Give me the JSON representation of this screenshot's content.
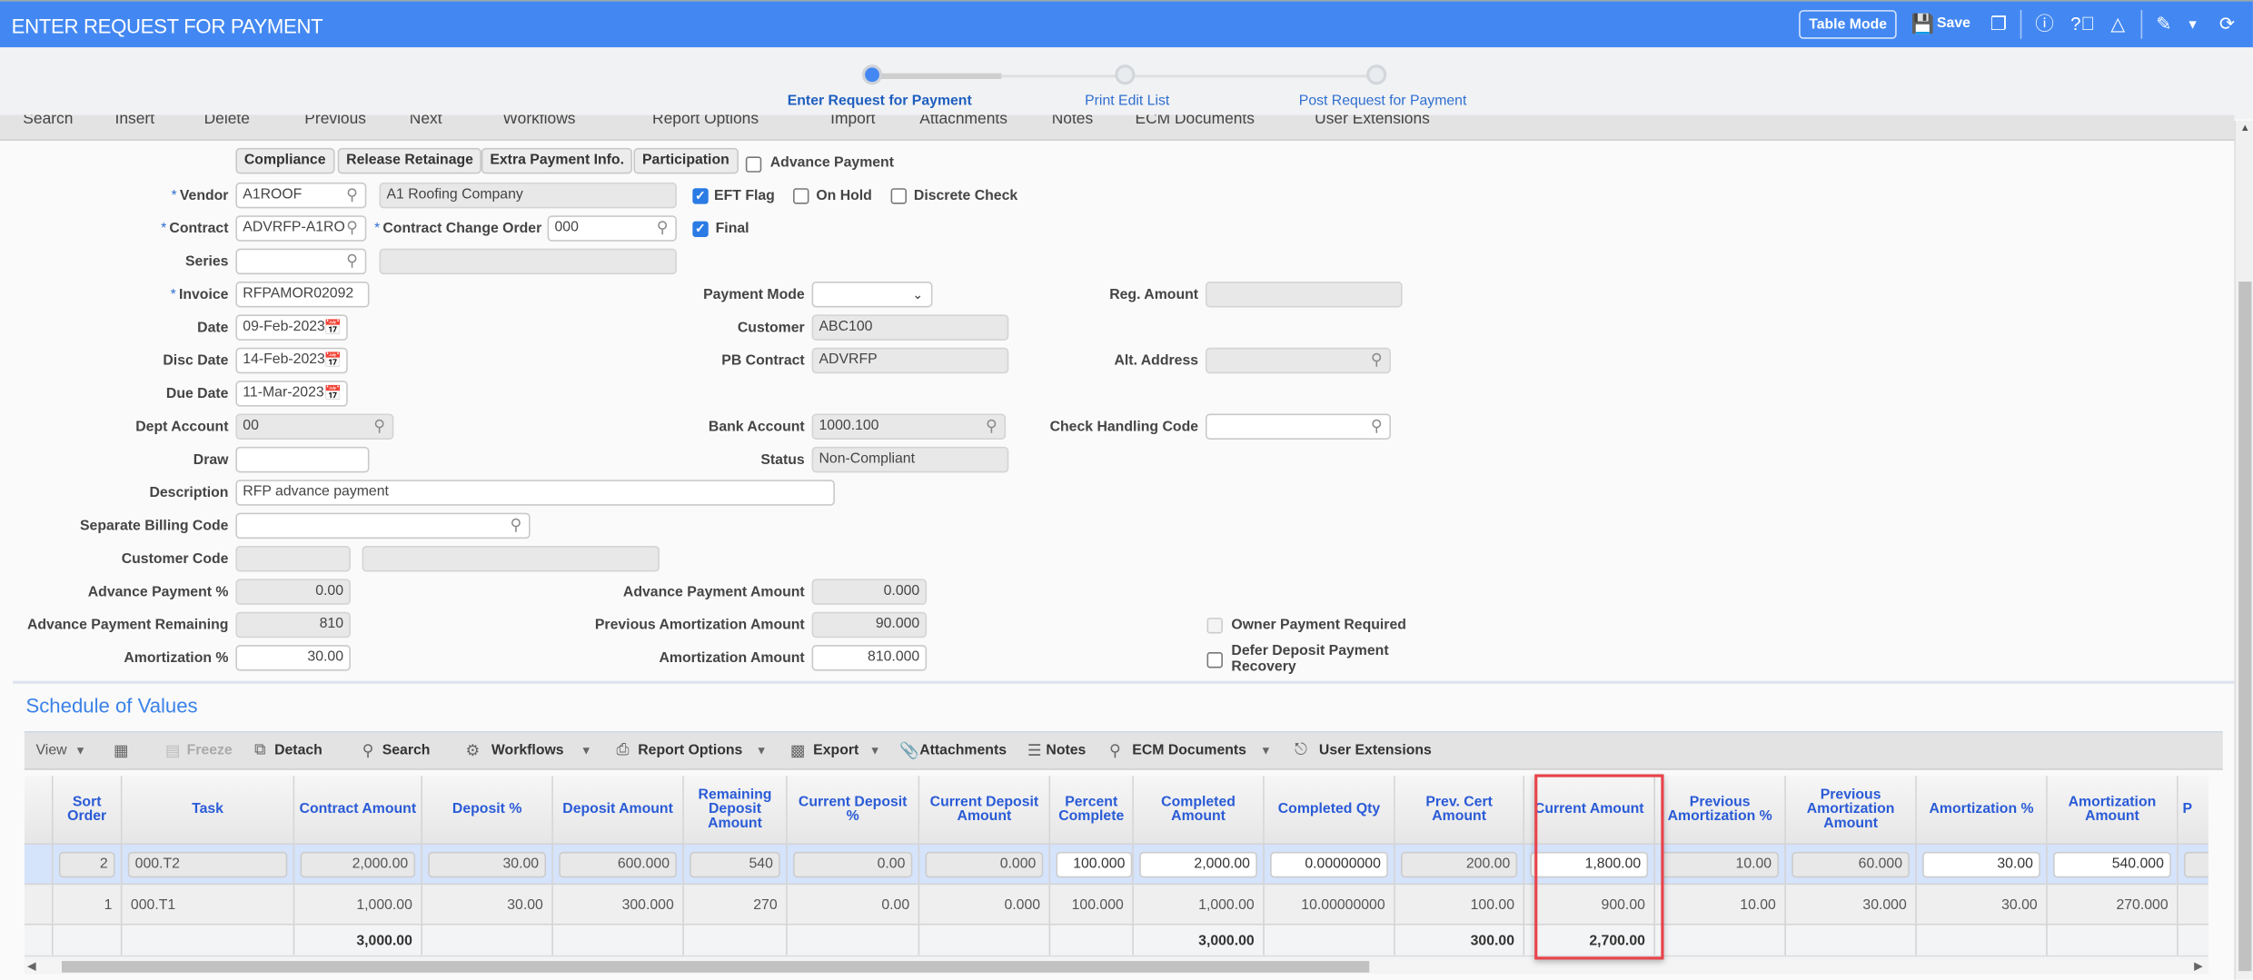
{
  "header": {
    "title": "ENTER REQUEST FOR PAYMENT",
    "table_mode_label": "Table Mode",
    "save_label": "Save",
    "icons": [
      "save-icon",
      "copy-icon",
      "info-icon",
      "help-icon",
      "warning-icon",
      "edit-icon",
      "dropdown-icon",
      "refresh-icon"
    ],
    "accent_color": "#4388f2"
  },
  "stepper": {
    "steps": [
      {
        "label": "Enter Request for Payment",
        "active": true
      },
      {
        "label": "Print Edit List",
        "active": false
      },
      {
        "label": "Post Request for Payment",
        "active": false
      }
    ]
  },
  "toolbar": {
    "items": [
      "Search",
      "Insert",
      "Delete",
      "Previous",
      "Next",
      "Workflows",
      "Report Options",
      "Import",
      "Attachments",
      "Notes",
      "ECM Documents",
      "User Extensions"
    ]
  },
  "form": {
    "buttons": [
      "Compliance",
      "Release Retainage",
      "Extra Payment Info.",
      "Participation"
    ],
    "advance_payment": {
      "label": "Advance Payment",
      "checked": false
    },
    "vendor": {
      "label": "Vendor",
      "value": "A1ROOF",
      "name": "A1 Roofing Company"
    },
    "eft_flag": {
      "label": "EFT Flag",
      "checked": true
    },
    "on_hold": {
      "label": "On Hold",
      "checked": false
    },
    "discrete_check": {
      "label": "Discrete Check",
      "checked": false
    },
    "contract": {
      "label": "Contract",
      "value": "ADVRFP-A1RO"
    },
    "contract_change_order": {
      "label": "Contract Change Order",
      "value": "000"
    },
    "final": {
      "label": "Final",
      "checked": true
    },
    "series": {
      "label": "Series",
      "value": "",
      "desc": ""
    },
    "invoice": {
      "label": "Invoice",
      "value": "RFPAMOR02092"
    },
    "payment_mode": {
      "label": "Payment Mode",
      "value": ""
    },
    "reg_amount": {
      "label": "Reg. Amount",
      "value": ""
    },
    "date": {
      "label": "Date",
      "value": "09-Feb-2023"
    },
    "customer": {
      "label": "Customer",
      "value": "ABC100"
    },
    "disc_date": {
      "label": "Disc Date",
      "value": "14-Feb-2023"
    },
    "pb_contract": {
      "label": "PB Contract",
      "value": "ADVRFP"
    },
    "alt_address": {
      "label": "Alt. Address",
      "value": ""
    },
    "due_date": {
      "label": "Due Date",
      "value": "11-Mar-2023"
    },
    "dept_account": {
      "label": "Dept Account",
      "value": "00"
    },
    "bank_account": {
      "label": "Bank Account",
      "value": "1000.100"
    },
    "check_handling_code": {
      "label": "Check Handling Code",
      "value": ""
    },
    "draw": {
      "label": "Draw",
      "value": ""
    },
    "status": {
      "label": "Status",
      "value": "Non-Compliant"
    },
    "description": {
      "label": "Description",
      "value": "RFP advance payment"
    },
    "separate_billing_code": {
      "label": "Separate Billing Code",
      "value": ""
    },
    "customer_code": {
      "label": "Customer Code",
      "value": "",
      "desc": ""
    },
    "advance_payment_pct": {
      "label": "Advance Payment %",
      "value": "0.00"
    },
    "advance_payment_amount": {
      "label": "Advance Payment Amount",
      "value": "0.000"
    },
    "advance_payment_remaining": {
      "label": "Advance Payment Remaining",
      "value": "810"
    },
    "previous_amortization_amount": {
      "label": "Previous Amortization Amount",
      "value": "90.000"
    },
    "owner_payment_required": {
      "label": "Owner Payment Required",
      "checked": false,
      "disabled": true
    },
    "amortization_pct": {
      "label": "Amortization %",
      "value": "30.00"
    },
    "amortization_amount": {
      "label": "Amortization Amount",
      "value": "810.000"
    },
    "defer_deposit": {
      "label": "Defer Deposit Payment Recovery",
      "line1": "Defer Deposit Payment",
      "line2": "Recovery",
      "checked": false
    }
  },
  "sov": {
    "title": "Schedule of Values",
    "toolbar": {
      "view": "View",
      "freeze": "Freeze",
      "detach": "Detach",
      "search": "Search",
      "workflows": "Workflows",
      "report_options": "Report Options",
      "export": "Export",
      "attachments": "Attachments",
      "notes": "Notes",
      "ecm_documents": "ECM Documents",
      "user_extensions": "User Extensions"
    },
    "columns": [
      "Sort Order",
      "Task",
      "Contract Amount",
      "Deposit %",
      "Deposit Amount",
      "Remaining Deposit Amount",
      "Current Deposit %",
      "Current Deposit Amount",
      "Percent Complete",
      "Completed Amount",
      "Completed Qty",
      "Prev. Cert Amount",
      "Current Amount",
      "Previous Amortization %",
      "Previous Amortization Amount",
      "Amortization %",
      "Amortization Amount",
      "P"
    ],
    "rows": [
      [
        "2",
        "000.T2",
        "2,000.00",
        "30.00",
        "600.000",
        "540",
        "0.00",
        "0.000",
        "100.000",
        "2,000.00",
        "0.00000000",
        "200.00",
        "1,800.00",
        "10.00",
        "60.000",
        "30.00",
        "540.000",
        ""
      ],
      [
        "1",
        "000.T1",
        "1,000.00",
        "30.00",
        "300.000",
        "270",
        "0.00",
        "0.000",
        "100.000",
        "1,000.00",
        "10.00000000",
        "100.00",
        "900.00",
        "10.00",
        "30.000",
        "30.00",
        "270.000",
        ""
      ]
    ],
    "totals": [
      "",
      "",
      "3,000.00",
      "",
      "",
      "",
      "",
      "",
      "",
      "3,000.00",
      "",
      "300.00",
      "2,700.00",
      "",
      "",
      "",
      "",
      ""
    ],
    "highlighted_column": "Current Amount"
  }
}
